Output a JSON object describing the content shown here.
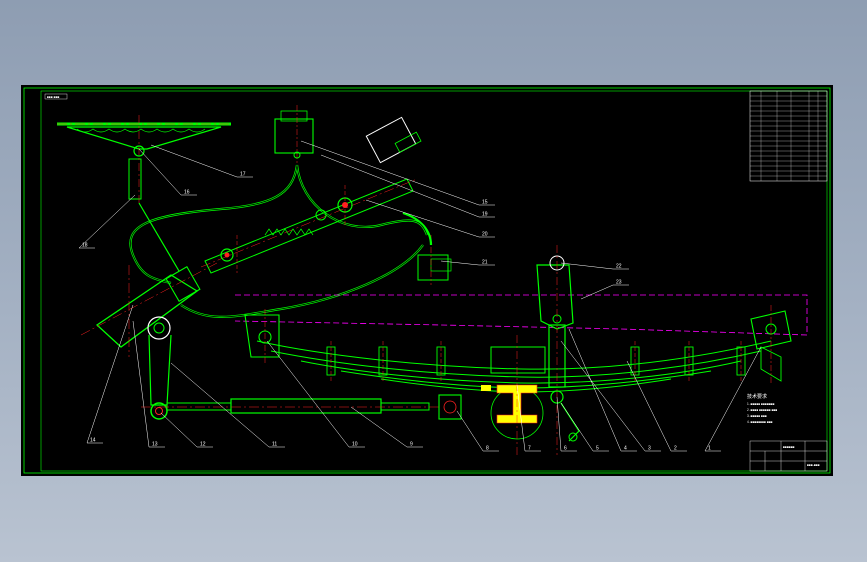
{
  "drawing": {
    "stamp": "■■■ ■■■",
    "balloons": [
      "16",
      "17",
      "15",
      "18",
      "19",
      "20",
      "21",
      "14",
      "13",
      "12",
      "11",
      "10",
      "9",
      "8",
      "7",
      "6",
      "5",
      "4",
      "3",
      "2",
      "1",
      "22",
      "23"
    ],
    "notes_title": "技术要求",
    "notes": [
      "1. ■■■■■ ■■■■■■■",
      "2. ■■■■ ■■■■■■ ■■■",
      "3. ■■■■■ ■■■",
      "4. ■■■■■■■■ ■■■"
    ],
    "title_block": {
      "name": "■■■■■■",
      "code": "■■■-■■■"
    }
  },
  "colors": {
    "frame": "#00ff00",
    "line": "#00ff00",
    "centerline": "#ff2020",
    "phantom": "#ff00ff",
    "leader": "#ffffff",
    "canvas": "#000000"
  }
}
